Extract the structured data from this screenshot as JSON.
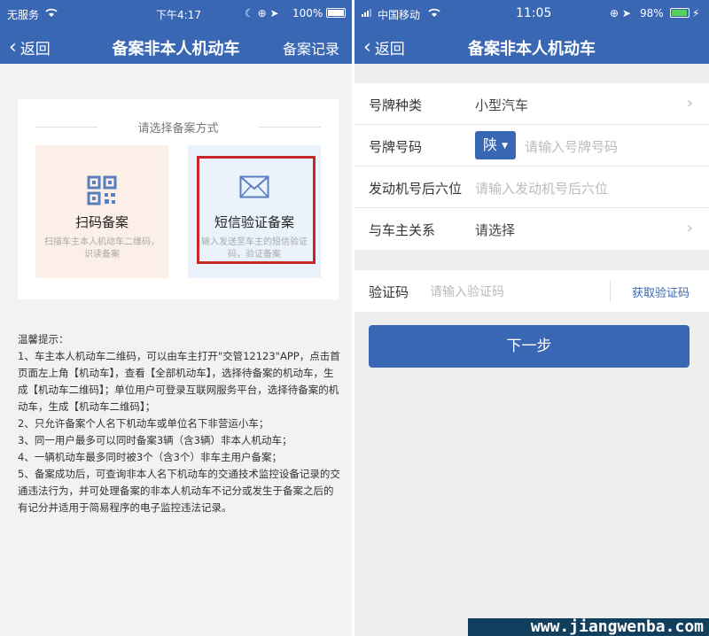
{
  "left": {
    "status": {
      "carrier": "无服务",
      "time": "下午4:17",
      "battery": "100%"
    },
    "nav": {
      "back": "返回",
      "title": "备案非本人机动车",
      "right": "备案记录"
    },
    "method": {
      "heading": "请选择备案方式",
      "options": [
        {
          "icon": "qr-code-icon",
          "label": "扫码备案",
          "desc": "扫描车主本人机动车二维码，识读备案"
        },
        {
          "icon": "envelope-icon",
          "label": "短信验证备案",
          "desc": "输入发送至车主的短信验证码，验证备案"
        }
      ]
    },
    "tips": [
      "温馨提示：",
      "1、车主本人机动车二维码，可以由车主打开\"交管12123\"APP，点击首页面左上角【机动车】，查看【全部机动车】，选择待备案的机动车，生成【机动车二维码】；单位用户可登录互联网服务平台，选择待备案的机动车，生成【机动车二维码】；",
      "2、只允许备案个人名下机动车或单位名下非营运小车；",
      "3、同一用户最多可以同时备案3辆（含3辆）非本人机动车；",
      "4、一辆机动车最多同时被3个（含3个）非车主用户备案；",
      "5、备案成功后，可查询非本人名下机动车的交通技术监控设备记录的交通违法行为，并可处理备案的非本人机动车不记分或发生于备案之后的有记分并适用于简易程序的电子监控违法记录。"
    ]
  },
  "right": {
    "status": {
      "carrier": "中国移动",
      "time": "11:05",
      "battery": "98%"
    },
    "nav": {
      "back": "返回",
      "title": "备案非本人机动车"
    },
    "form": {
      "plate_type": {
        "label": "号牌种类",
        "value": "小型汽车"
      },
      "plate_number": {
        "label": "号牌号码",
        "province": "陕",
        "placeholder": "请输入号牌号码"
      },
      "engine": {
        "label": "发动机号后六位",
        "placeholder": "请输入发动机号后六位"
      },
      "relation": {
        "label": "与车主关系",
        "value": "请选择"
      }
    },
    "code": {
      "label": "验证码",
      "placeholder": "请输入验证码",
      "get_code": "获取验证码"
    },
    "next_button": "下一步"
  },
  "watermark": "www.jiangwenba.com",
  "colors": {
    "brand_blue": "#3a67b4",
    "highlight_red": "#c62828"
  }
}
